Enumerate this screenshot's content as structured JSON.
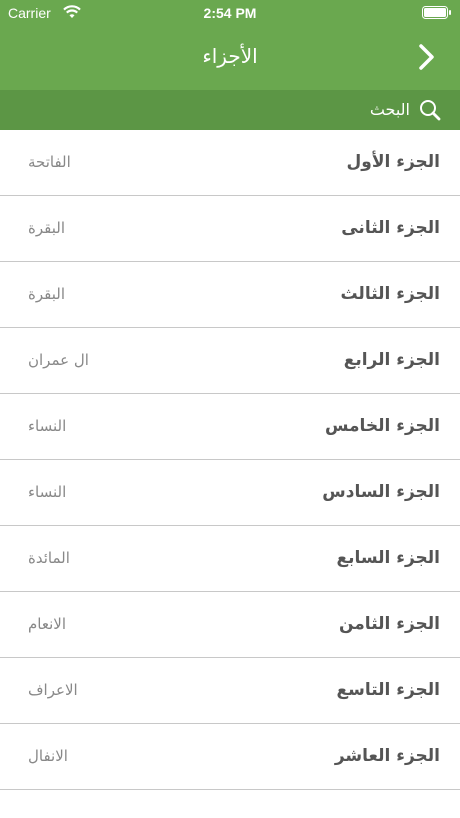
{
  "status_bar": {
    "carrier": "Carrier",
    "time": "2:54 PM"
  },
  "nav": {
    "title": "الأجزاء",
    "back_icon": "chevron-right-icon"
  },
  "search": {
    "label": "البحث",
    "icon": "search-icon"
  },
  "colors": {
    "nav_green": "#6aa84f",
    "search_green": "#5c9645"
  },
  "juz_list": [
    {
      "name": "الجزء الأول",
      "surah": "الفاتحة"
    },
    {
      "name": "الجزء الثانى",
      "surah": "البقرة"
    },
    {
      "name": "الجزء الثالث",
      "surah": "البقرة"
    },
    {
      "name": "الجزء الرابع",
      "surah": "ال عمران"
    },
    {
      "name": "الجزء الخامس",
      "surah": "النساء"
    },
    {
      "name": "الجزء السادس",
      "surah": "النساء"
    },
    {
      "name": "الجزء السابع",
      "surah": "المائدة"
    },
    {
      "name": "الجزء الثامن",
      "surah": "الانعام"
    },
    {
      "name": "الجزء التاسع",
      "surah": "الاعراف"
    },
    {
      "name": "الجزء العاشر",
      "surah": "الانفال"
    }
  ]
}
